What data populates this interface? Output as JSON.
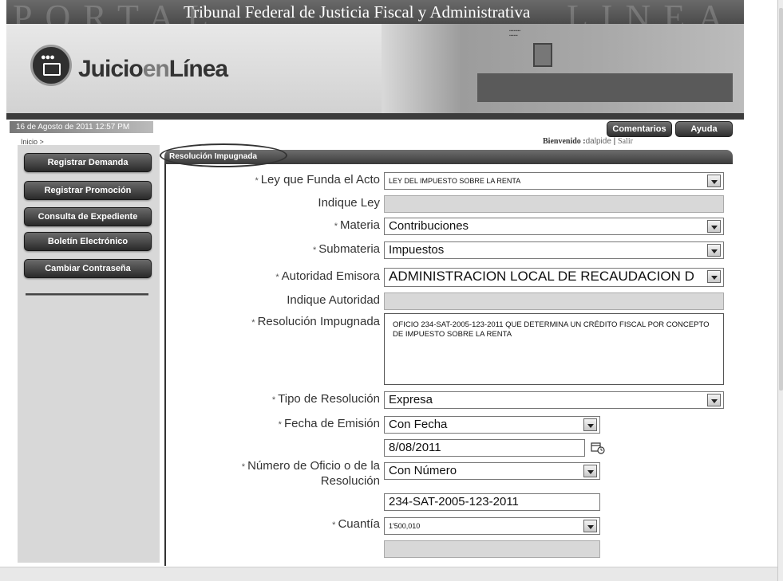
{
  "header": {
    "banner_title": "Tribunal Federal de Justicia Fiscal y Administrativa",
    "banner_watermark_left": "PORTAL",
    "banner_watermark_right": "LINEA",
    "logo_main": "Juicio",
    "logo_en": "en",
    "logo_linea": "Línea",
    "logo_icon": "people-computer-icon"
  },
  "infobar": {
    "datetime": "16 de Agosto de 2011 12:57 PM",
    "comentarios": "Comentarios",
    "ayuda": "Ayuda",
    "breadcrumb": "Inicio >",
    "welcome_label": "Bienvenido :",
    "welcome_user": "dalpide",
    "welcome_sep": " | ",
    "welcome_salir": "Salir"
  },
  "sidebar": {
    "items": [
      {
        "label": "Registrar Demanda"
      },
      {
        "label": "Registrar Promoción"
      },
      {
        "label": "Consulta de Expediente"
      },
      {
        "label": "Boletín Electrónico"
      },
      {
        "label": "Cambiar Contraseña"
      }
    ]
  },
  "form": {
    "section_title": "Resolución Impugnada",
    "required_mark": "*",
    "fields": {
      "ley_label": "Ley que Funda el Acto",
      "ley_value": "LEY DEL IMPUESTO SOBRE LA RENTA",
      "indique_ley_label": "Indique Ley",
      "indique_ley_value": "",
      "materia_label": "Materia",
      "materia_value": "Contribuciones",
      "submateria_label": "Submateria",
      "submateria_value": "Impuestos",
      "autoridad_label": "Autoridad Emisora",
      "autoridad_value": "ADMINISTRACION LOCAL DE RECAUDACION D",
      "indique_autoridad_label": "Indique Autoridad",
      "indique_autoridad_value": "",
      "resolucion_label": "Resolución Impugnada",
      "resolucion_value": "OFICIO 234-SAT-2005-123-2011 QUE DETERMINA UN CRÉDITO FISCAL POR CONCEPTO DE IMPUESTO SOBRE LA RENTA",
      "tipo_label": "Tipo de Resolución",
      "tipo_value": "Expresa",
      "fecha_label": "Fecha de Emisión",
      "fecha_select_value": "Con Fecha",
      "fecha_date_value": "8/08/2011",
      "numero_label_line1": "Número de Oficio o de la",
      "numero_label_line2": "Resolución",
      "numero_select_value": "Con Número",
      "numero_value": "234-SAT-2005-123-2011",
      "cuantia_label": "Cuantía",
      "cuantia_select_value": "1'500,010",
      "extra_value": ""
    }
  },
  "icons": {
    "calendar": "calendar-icon",
    "dropdown": "chevron-down-icon"
  }
}
